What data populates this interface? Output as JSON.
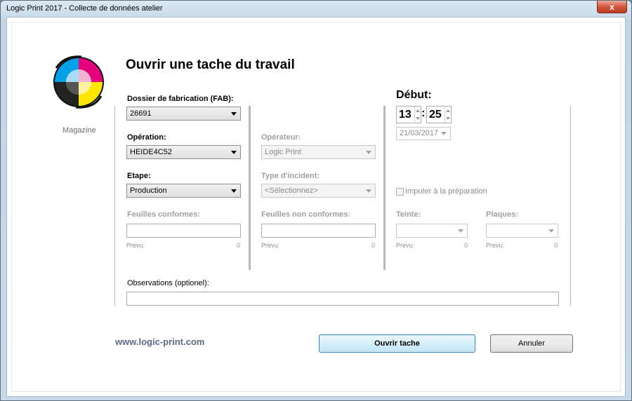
{
  "window": {
    "title": "Logic Print 2017 - Collecte de données atelier",
    "close_glyph": "x"
  },
  "logo": {
    "caption": "Magazine"
  },
  "heading": "Ouvrir une tache du travail",
  "col1": {
    "fab": {
      "label": "Dossier de fabrication (FAB):",
      "value": "26691"
    },
    "operation": {
      "label": "Opération:",
      "value": "HEIDE4C52"
    },
    "etape": {
      "label": "Etape:",
      "value": "Production"
    },
    "feuilles_conformes": {
      "label": "Feuilles conformes:",
      "value": "",
      "prevu_label": "Prevu:",
      "prevu_value": "0"
    }
  },
  "col2": {
    "operateur": {
      "label": "Opérateur:",
      "value": "Logic Print"
    },
    "incident": {
      "label": "Type d'incident:",
      "value": "<Sélectionnez>"
    },
    "feuilles_non_conformes": {
      "label": "Feuilles non conformes:",
      "value": "",
      "prevu_label": "Prevu:",
      "prevu_value": "0"
    }
  },
  "col3": {
    "debut": {
      "label": "Début:",
      "hour": "13",
      "sep": ":",
      "minute": "25",
      "date": "21/03/2017"
    },
    "imputer": {
      "label": "Imputer à la préparation",
      "checked": false
    },
    "teinte": {
      "label": "Teinte:",
      "value": "",
      "prevu_label": "Prevu:",
      "prevu_value": "0"
    },
    "plaques": {
      "label": "Plaques:",
      "value": "",
      "prevu_label": "Prevu:",
      "prevu_value": "0"
    }
  },
  "observations": {
    "label": "Observations (optionel):",
    "value": ""
  },
  "footer": {
    "website": "www.logic-print.com",
    "open_button": "Ouvrir tache",
    "cancel_button": "Annuler"
  }
}
